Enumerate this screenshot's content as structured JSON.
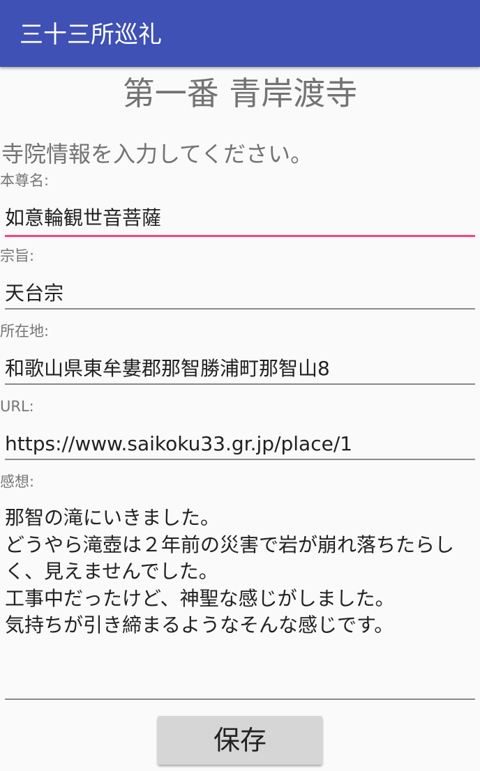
{
  "app_bar": {
    "title": "三十三所巡礼"
  },
  "page": {
    "heading": "第一番 青岸渡寺",
    "instruction": "寺院情報を入力してください。"
  },
  "form": {
    "honzon": {
      "label": "本尊名:",
      "value": "如意輪観世音菩薩"
    },
    "shushi": {
      "label": "宗旨:",
      "value": "天台宗"
    },
    "address": {
      "label": "所在地:",
      "value": "和歌山県東牟婁郡那智勝浦町那智山8"
    },
    "url": {
      "label": "URL:",
      "value": "https://www.saikoku33.gr.jp/place/1"
    },
    "impressions": {
      "label": "感想:",
      "value": "那智の滝にいきました。\nどうやら滝壺は２年前の災害で岩が崩れ落ちたらしく、見えませんでした。\n工事中だったけど、神聖な感じがしました。\n気持ちが引き締まるようなそんな感じです。"
    },
    "save_label": "保存"
  },
  "colors": {
    "app_bar": "#3f51b5",
    "focus_underline": "#ff4081",
    "background": "#fafafa",
    "button": "#d6d6d6"
  }
}
